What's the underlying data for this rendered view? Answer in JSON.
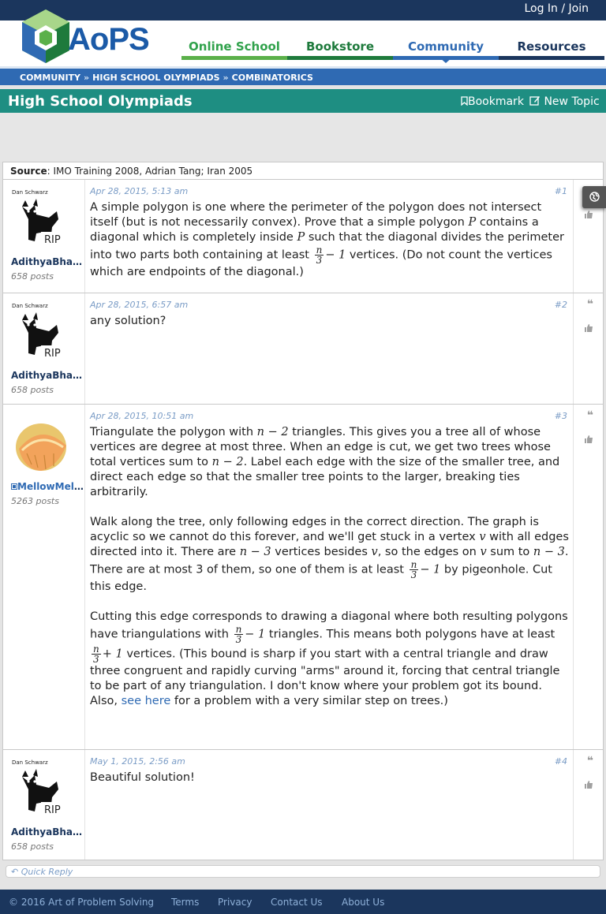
{
  "header": {
    "login_label": "Log In / Join",
    "logo_text": "AoPS",
    "nav": [
      {
        "label": "Online School"
      },
      {
        "label": "Bookstore"
      },
      {
        "label": "Community"
      },
      {
        "label": "Resources"
      }
    ]
  },
  "breadcrumb": [
    "COMMUNITY",
    "HIGH SCHOOL OLYMPIADS",
    "COMBINATORICS"
  ],
  "breadcrumb_sep": "»",
  "forum": {
    "title": "High School Olympiads",
    "bookmark_label": "Bookmark",
    "new_topic_label": "New Topic"
  },
  "source": {
    "label": "Source",
    "text": ": IMO Training 2008, Adrian Tang; Iran 2005"
  },
  "posts": [
    {
      "number": "#1",
      "date": "Apr 28, 2015, 5:13 am",
      "author": "AdithyaBhas...",
      "posts_count": "658 posts",
      "avatar_caption_top": "Dan Schwarz",
      "avatar_caption_bottom": "RIP",
      "body": {
        "t1": "A simple polygon is one where the perimeter of the polygon does not intersect itself (but is not necessarily convex). Prove that a simple polygon",
        "m1": "P",
        "t2": "contains a diagonal which is completely inside",
        "m2": "P",
        "t3": "such that the diagonal divides the perimeter into two parts both containing at least",
        "frac_num": "n",
        "frac_den": "3",
        "m3": "− 1",
        "t4": "vertices. (Do not count the vertices which are endpoints of the diagonal.)"
      }
    },
    {
      "number": "#2",
      "date": "Apr 28, 2015, 6:57 am",
      "author": "AdithyaBhas...",
      "posts_count": "658 posts",
      "avatar_caption_top": "Dan Schwarz",
      "avatar_caption_bottom": "RIP",
      "body": {
        "t1": "any solution?"
      }
    },
    {
      "number": "#3",
      "date": "Apr 28, 2015, 10:51 am",
      "author": "MellowMelon",
      "posts_count": "5263 posts",
      "body": {
        "a1": "Triangulate the polygon with",
        "am1": "n − 2",
        "a2": "triangles. This gives you a tree all of whose vertices are degree at most three. When an edge is cut, we get two trees whose total vertices sum to",
        "am2": "n − 2",
        "a3": ". Label each edge with the size of the smaller tree, and direct each edge so that the smaller tree points to the larger, breaking ties arbitrarily.",
        "b1": "Walk along the tree, only following edges in the correct direction. The graph is acyclic so we cannot do this forever, and we'll get stuck in a vertex",
        "bm1": "v",
        "b2": "with all edges directed into it. There are",
        "bm2": "n − 3",
        "b3": "vertices besides",
        "bm3": "v",
        "b4": ", so the edges on",
        "bm4": "v",
        "b5": "sum to",
        "bm5": "n − 3",
        "b6": ". There are at most 3 of them, so one of them is at least",
        "bf_num": "n",
        "bf_den": "3",
        "bm6": "− 1",
        "b7": "by pigeonhole. Cut this edge.",
        "c1": "Cutting this edge corresponds to drawing a diagonal where both resulting polygons have triangulations with",
        "cf1_num": "n",
        "cf1_den": "3",
        "cm1": "− 1",
        "c2": "triangles. This means both polygons have at least",
        "cf2_num": "n",
        "cf2_den": "3",
        "cm2": "+ 1",
        "c3": "vertices. (This bound is sharp if you start with a central triangle and draw three congruent and rapidly curving \"arms\" around it, forcing that central triangle to be part of any triangulation. I don't know where your problem got its bound. Also,",
        "link": "see here",
        "c4": "for a problem with a very similar step on trees.)"
      }
    },
    {
      "number": "#4",
      "date": "May 1, 2015, 2:56 am",
      "author": "AdithyaBhas...",
      "posts_count": "658 posts",
      "avatar_caption_top": "Dan Schwarz",
      "avatar_caption_bottom": "RIP",
      "body": {
        "t1": "Beautiful solution!"
      }
    }
  ],
  "quick_reply_label": "Quick Reply",
  "footer": {
    "copyright": "© 2016 Art of Problem Solving",
    "links": [
      "Terms",
      "Privacy",
      "Contact Us",
      "About Us"
    ]
  },
  "icons": [
    "globe-icon",
    "quote-icon",
    "thumbs-up-icon",
    "bookmark-icon",
    "edit-icon",
    "reply-icon",
    "mod-badge-icon"
  ],
  "colors": {
    "top_bar": "#1b365d",
    "forum_bar": "#1e8e82",
    "breadcrumb_bar": "#2f6ab3",
    "link": "#2f6ab3"
  }
}
